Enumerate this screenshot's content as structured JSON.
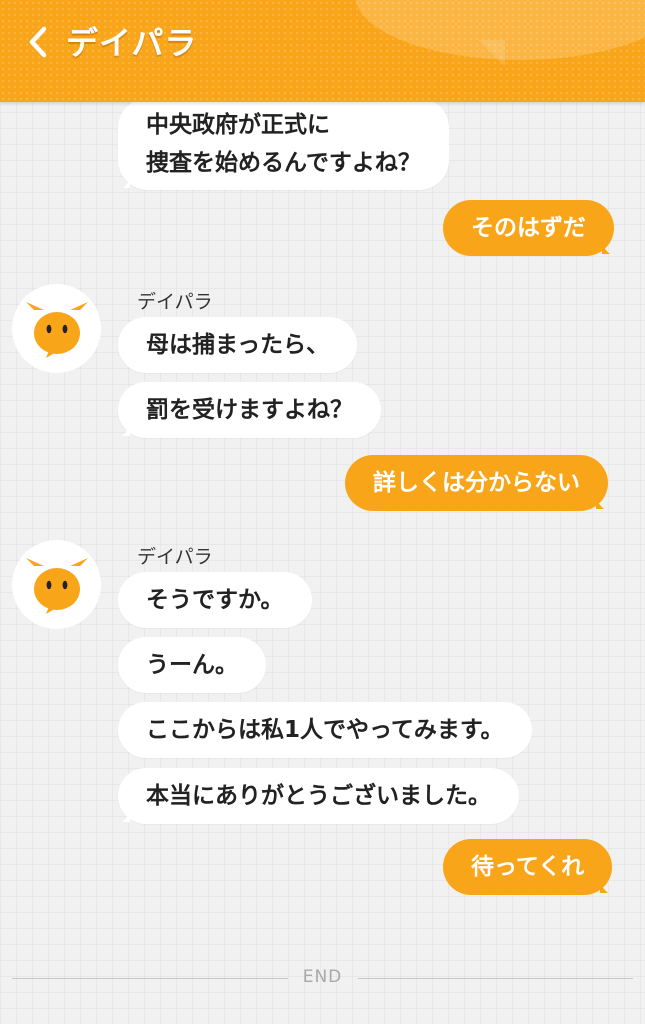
{
  "header": {
    "title": "デイパラ",
    "back_icon": "chevron-left-icon",
    "color": "#f9a51a"
  },
  "colors": {
    "accent": "#f9a51a",
    "incoming_bubble": "#ffffff",
    "background": "#f1f1f1"
  },
  "messages": [
    {
      "side": "in",
      "text": "中央政府が正式に\n捜査を始めるんですよね？"
    },
    {
      "side": "out",
      "text": "そのはずだ"
    },
    {
      "side": "in",
      "sender": "デイパラ",
      "text": "母は捕まったら、"
    },
    {
      "side": "in",
      "text": "罰を受けますよね？"
    },
    {
      "side": "out",
      "text": "詳しくは分からない"
    },
    {
      "side": "in",
      "sender": "デイパラ",
      "text": "そうですか。"
    },
    {
      "side": "in",
      "text": "うーん。"
    },
    {
      "side": "in",
      "text": "ここからは私1人でやってみます。"
    },
    {
      "side": "in",
      "text": "本当にありがとうございました。"
    },
    {
      "side": "out",
      "text": "待ってくれ"
    }
  ],
  "footer": {
    "end_label": "END"
  }
}
